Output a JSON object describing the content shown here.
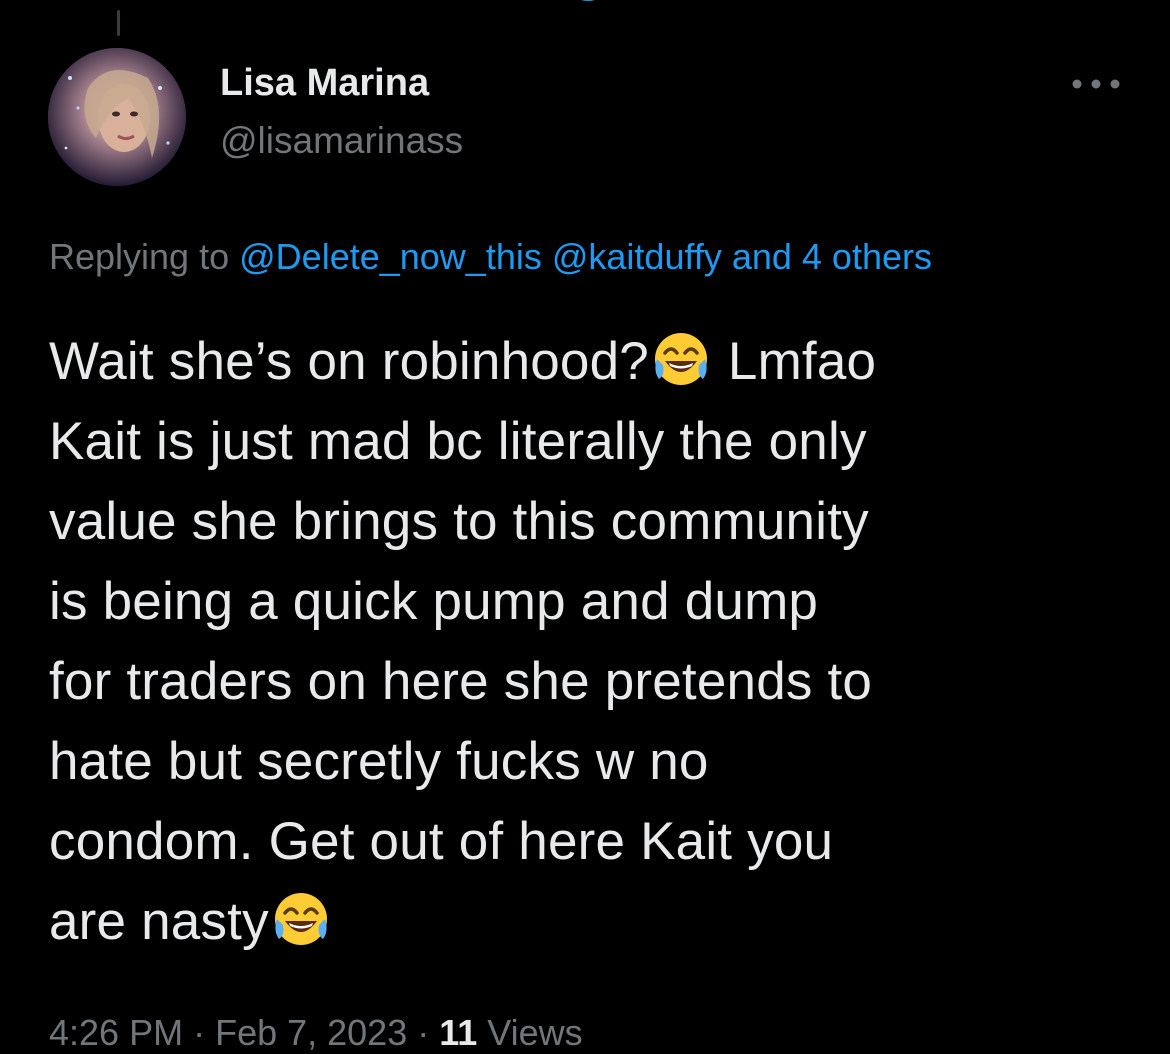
{
  "tweet": {
    "author_name": "Lisa Marina",
    "author_handle": "@lisamarinass",
    "replying_prefix": "Replying to",
    "replying_mentions": [
      "@Delete_now_this",
      "@kaitduffy",
      "and 4 others"
    ],
    "text_lines": [
      [
        "Wait she’s on robinhood?",
        "laughing-emoji",
        " Lmfao"
      ],
      [
        "Kait is just mad bc literally the only"
      ],
      [
        "value she brings to this community"
      ],
      [
        "is being a quick pump and dump"
      ],
      [
        "for traders on here she pretends to"
      ],
      [
        "hate but secretly fucks w no"
      ],
      [
        "condom. Get out of here Kait you"
      ],
      [
        "are nasty",
        "laughing-emoji"
      ]
    ],
    "line_texts": {
      "l1a": "Wait she’s on robinhood?",
      "l1b": " Lmfao",
      "l2": "Kait is just mad bc literally the only",
      "l3": "value she brings to this community",
      "l4": "is being a quick pump and dump",
      "l5": "for traders on here she pretends to",
      "l6": "hate but secretly fucks w no",
      "l7": "condom. Get out of here Kait you",
      "l8": "are nasty"
    },
    "meta": {
      "time": "4:26 PM",
      "separator": " · ",
      "date": "Feb 7, 2023",
      "views_count": "11",
      "views_label": " Views"
    }
  },
  "icons": {
    "more": "more-horizontal-icon",
    "emoji": "face-with-tears-of-joy-emoji",
    "loader": "loading-spinner-icon"
  },
  "colors": {
    "background": "#000000",
    "text": "#e7e9ea",
    "secondary": "#71767b",
    "accent": "#1d9bf0"
  }
}
